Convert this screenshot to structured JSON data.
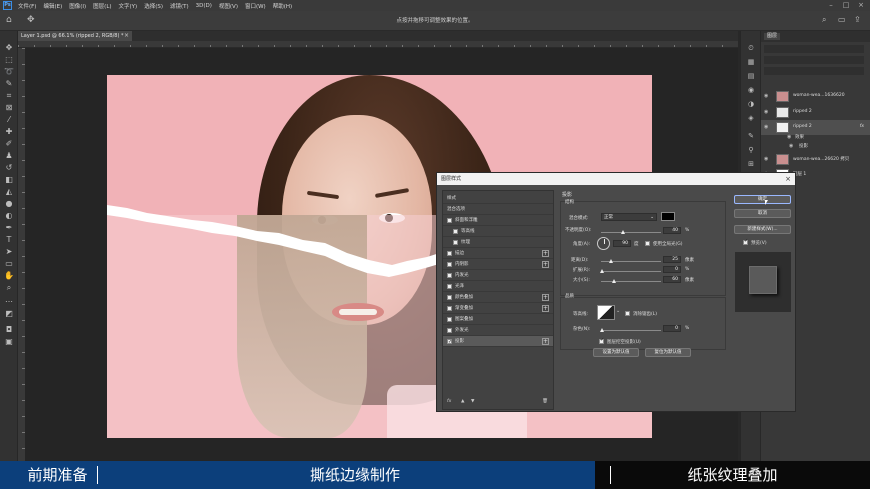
{
  "app": {
    "logo": "Ps",
    "menu": [
      "文件(F)",
      "编辑(E)",
      "图像(I)",
      "图层(L)",
      "文字(Y)",
      "选择(S)",
      "滤镜(T)",
      "3D(D)",
      "视图(V)",
      "窗口(W)",
      "帮助(H)"
    ],
    "option_hint": "点按并拖移可调整效果的位置。",
    "window_controls": [
      "–",
      "□",
      "×"
    ]
  },
  "document": {
    "tab_label": "Layer 1.psd @ 66.1% (ripped 2, RGB/8) *",
    "tab_close": "×"
  },
  "layers_panel": {
    "tab": "图层",
    "rows": [
      {
        "name": "woman-wea...1636620",
        "type": "layer"
      },
      {
        "name": "ripped 2",
        "type": "layer"
      },
      {
        "name": "ripped 2",
        "type": "layer",
        "fx": "fx"
      },
      {
        "name": "效果",
        "type": "sub"
      },
      {
        "name": "投影",
        "type": "sub"
      },
      {
        "name": "woman-wea...26620 拷贝",
        "type": "layer"
      },
      {
        "name": "图层 1",
        "type": "layer"
      }
    ]
  },
  "dialog": {
    "title": "图层样式",
    "close": "×",
    "styles": [
      {
        "label": "样式",
        "checkbox": false,
        "plus": false,
        "kind": "plain"
      },
      {
        "label": "混合选项",
        "checkbox": false,
        "plus": false,
        "kind": "plain"
      },
      {
        "label": "斜面和浮雕",
        "checkbox": true,
        "checked": false,
        "plus": false,
        "kind": "normal"
      },
      {
        "label": "等高线",
        "checkbox": true,
        "checked": false,
        "plus": false,
        "kind": "indent"
      },
      {
        "label": "纹理",
        "checkbox": true,
        "checked": false,
        "plus": false,
        "kind": "indent"
      },
      {
        "label": "描边",
        "checkbox": true,
        "checked": false,
        "plus": true,
        "kind": "normal"
      },
      {
        "label": "内阴影",
        "checkbox": true,
        "checked": false,
        "plus": true,
        "kind": "normal"
      },
      {
        "label": "内发光",
        "checkbox": true,
        "checked": false,
        "plus": false,
        "kind": "normal"
      },
      {
        "label": "光泽",
        "checkbox": true,
        "checked": false,
        "plus": false,
        "kind": "normal"
      },
      {
        "label": "颜色叠加",
        "checkbox": true,
        "checked": false,
        "plus": true,
        "kind": "normal"
      },
      {
        "label": "渐变叠加",
        "checkbox": true,
        "checked": false,
        "plus": true,
        "kind": "normal"
      },
      {
        "label": "图案叠加",
        "checkbox": true,
        "checked": false,
        "plus": false,
        "kind": "normal"
      },
      {
        "label": "外发光",
        "checkbox": true,
        "checked": false,
        "plus": false,
        "kind": "normal"
      },
      {
        "label": "投影",
        "checkbox": true,
        "checked": true,
        "plus": true,
        "kind": "normal",
        "active": true
      }
    ],
    "list_footer": "fx  ◆  ◆",
    "drop_shadow": {
      "section": "投影",
      "structure": "结构",
      "blend_mode_label": "混合模式:",
      "blend_mode": "正常",
      "shadow_color": "#000000",
      "opacity_label": "不透明度(O):",
      "opacity": "40",
      "opacity_unit": "%",
      "angle_label": "角度(A):",
      "angle": "90",
      "angle_unit": "度",
      "global_light_label": "使用全局光(G)",
      "global_light": false,
      "distance_label": "距离(D):",
      "distance": "25",
      "distance_unit": "像素",
      "spread_label": "扩展(R):",
      "spread": "0",
      "spread_unit": "%",
      "size_label": "大小(S):",
      "size": "60",
      "size_unit": "像素",
      "quality": "品质",
      "contour_label": "等高线:",
      "anti_alias_label": "消除锯齿(L)",
      "anti_alias": false,
      "noise_label": "杂色(N):",
      "noise": "0",
      "noise_unit": "%",
      "knockout_label": "图层挖空投影(U)",
      "knockout": true,
      "set_default": "设置为默认值",
      "reset_default": "复位为默认值"
    },
    "buttons": {
      "ok": "确定",
      "cancel": "取消",
      "new_style": "新建样式(W)...",
      "preview_label": "预览(V)",
      "preview": true
    }
  },
  "bottom_bar": {
    "step1": "前期准备",
    "step2": "撕纸边缘制作",
    "step3": "纸张纹理叠加",
    "active_color": "#0c3f7b"
  }
}
